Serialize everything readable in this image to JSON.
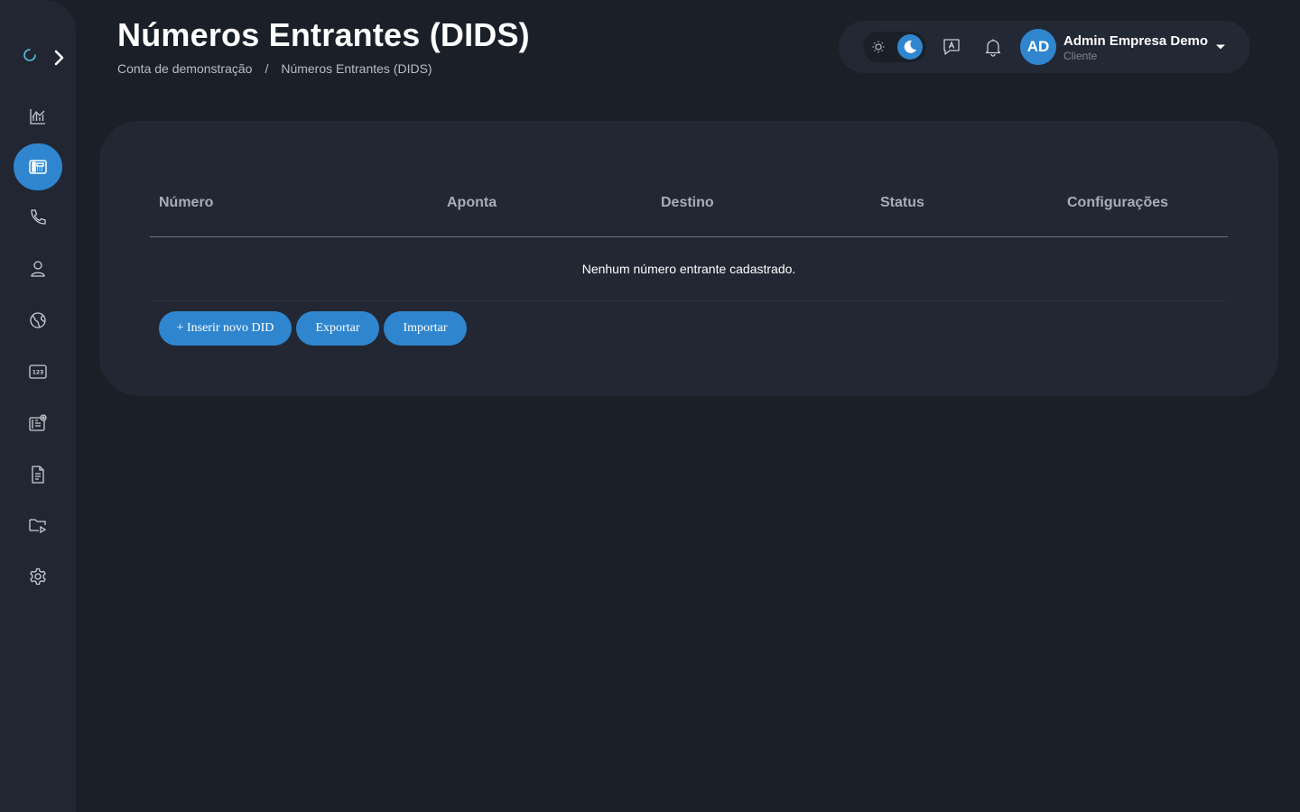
{
  "page": {
    "title": "Números Entrantes (DIDS)",
    "breadcrumb": {
      "root": "Conta de demonstração",
      "separator": "/",
      "current": "Números Entrantes (DIDS)"
    }
  },
  "sidebar": {
    "items": [
      {
        "icon": "chart-icon"
      },
      {
        "icon": "incoming-numbers-icon",
        "active": true
      },
      {
        "icon": "phone-icon"
      },
      {
        "icon": "user-icon"
      },
      {
        "icon": "globe-icon"
      },
      {
        "icon": "numbers-123-icon"
      },
      {
        "icon": "contacts-card-icon"
      },
      {
        "icon": "document-icon"
      },
      {
        "icon": "folder-media-icon"
      },
      {
        "icon": "settings-icon"
      }
    ]
  },
  "header": {
    "user": {
      "initials": "AD",
      "name": "Admin Empresa Demo",
      "role": "Cliente"
    },
    "theme": "dark"
  },
  "table": {
    "columns": [
      "Número",
      "Aponta",
      "Destino",
      "Status",
      "Configurações"
    ],
    "empty_message": "Nenhum número entrante cadastrado."
  },
  "actions": {
    "insert_label": "+ Inserir novo DID",
    "export_label": "Exportar",
    "import_label": "Importar"
  },
  "colors": {
    "accent": "#2f86cf",
    "background": "#1b1f27",
    "surface": "#222733"
  }
}
